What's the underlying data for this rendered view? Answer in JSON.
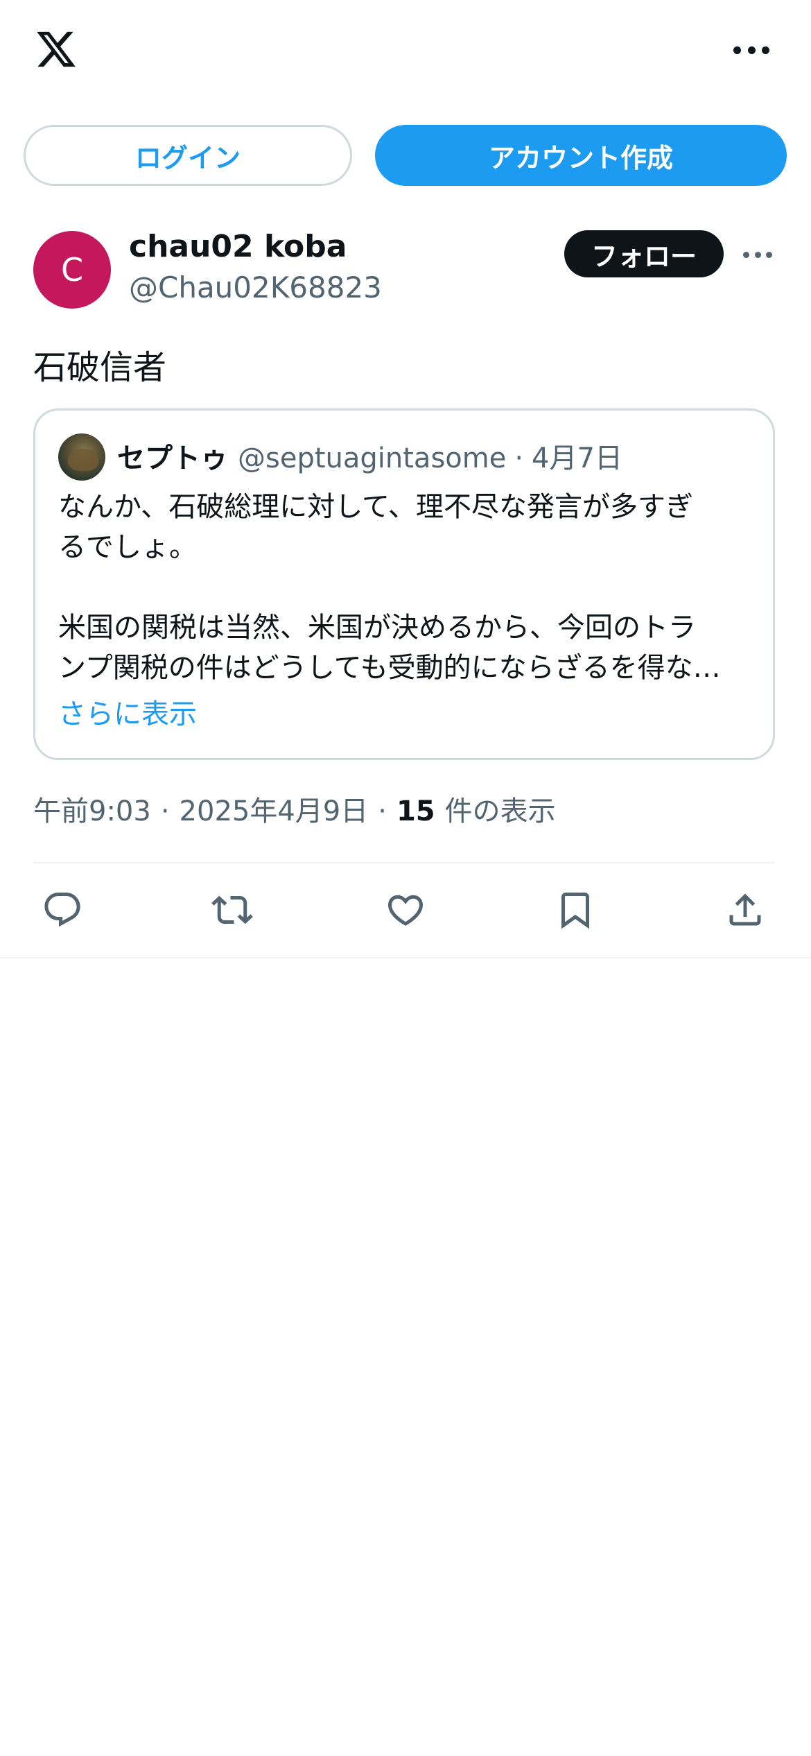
{
  "header": {
    "logo_icon": "x-logo-icon",
    "more_icon": "more-horizontal-icon"
  },
  "auth": {
    "login_label": "ログイン",
    "signup_label": "アカウント作成"
  },
  "post": {
    "author": {
      "avatar_letter": "C",
      "avatar_color": "#c4175c",
      "name": "chau02 koba",
      "handle": "@Chau02K68823"
    },
    "follow_label": "フォロー",
    "text": "石破信者",
    "quote": {
      "author_name": "セプトゥ",
      "author_handle": "@septuagintasome",
      "separator": "·",
      "date": "4月7日",
      "lines": [
        "なんか、石破総理に対して、理不尽な発言が多すぎ",
        "るでしょ。",
        "",
        "米国の関税は当然、米国が決めるから、今回のトラ",
        "ンプ関税の件はどうしても受動的にならざるを得な…"
      ],
      "show_more_label": "さらに表示"
    },
    "meta": {
      "time": "午前9:03",
      "separator": "·",
      "date": "2025年4月9日",
      "views_count": "15",
      "views_label": "件の表示"
    },
    "actions": [
      "reply-icon",
      "repost-icon",
      "like-icon",
      "bookmark-icon",
      "share-icon"
    ]
  },
  "colors": {
    "accent": "#1d9bf0",
    "text_primary": "#0f1419",
    "text_secondary": "#536471",
    "border": "#cfd9de"
  }
}
